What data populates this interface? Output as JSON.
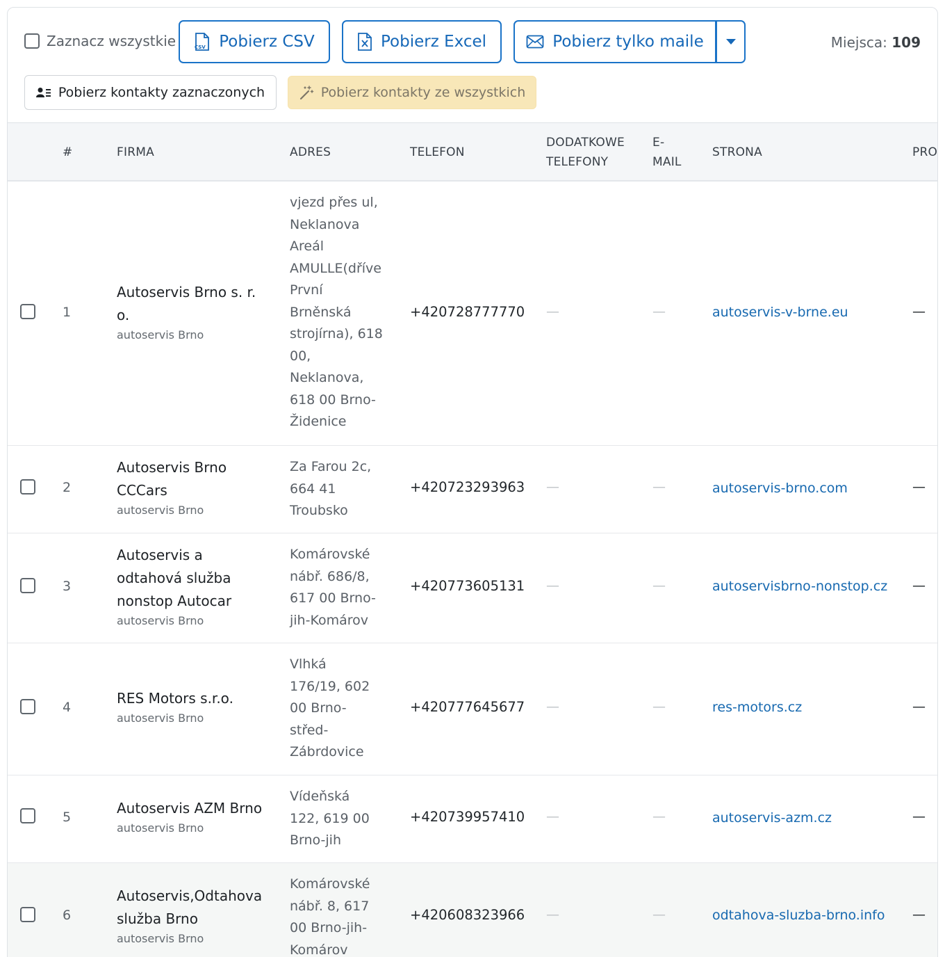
{
  "toolbar": {
    "select_all": "Zaznacz wszystkie",
    "csv": "Pobierz CSV",
    "excel": "Pobierz Excel",
    "mail": "Pobierz tylko maile",
    "seats_label": "Miejsca:",
    "seats_value": "109",
    "contacts_selected": "Pobierz kontakty zaznaczonych",
    "contacts_all": "Pobierz kontakty ze wszystkich"
  },
  "headers": {
    "num": "#",
    "firm": "FIRMA",
    "address": "ADRES",
    "phone": "TELEFON",
    "extra_phones_1": "DODATKOWE",
    "extra_phones_2": "TELEFONY",
    "email_1": "E-",
    "email_2": "MAIL",
    "site": "STRONA",
    "pro": "PRO"
  },
  "empty": "—",
  "rows": [
    {
      "num": "1",
      "firm_line1": "Autoservis Brno s. r.",
      "firm_line2": "o.",
      "category": "autoservis Brno",
      "addr": [
        "vjezd přes ul,",
        "Neklanova",
        "Areál",
        "AMULLE(dříve",
        "První",
        "Brněnská",
        "strojírna), 618",
        "00,",
        "Neklanova,",
        "618 00 Brno-",
        "Židenice"
      ],
      "phone": "+420728777770",
      "site": "autoservis-v-brne.eu"
    },
    {
      "num": "2",
      "firm_line1": "Autoservis Brno",
      "firm_line2": "CCCars",
      "category": "autoservis Brno",
      "addr": [
        "Za Farou 2c,",
        "664 41",
        "Troubsko"
      ],
      "phone": "+420723293963",
      "site": "autoservis-brno.com"
    },
    {
      "num": "3",
      "firm_line1": "Autoservis a",
      "firm_line2": "odtahová služba",
      "firm_line3": "nonstop Autocar",
      "category": "autoservis Brno",
      "addr": [
        "Komárovské",
        "nábř. 686/8,",
        "617 00 Brno-",
        "jih-Komárov"
      ],
      "phone": "+420773605131",
      "site": "autoservisbrno-nonstop.cz"
    },
    {
      "num": "4",
      "firm_line1": "RES Motors s.r.o.",
      "category": "autoservis Brno",
      "addr": [
        "Vlhká",
        "176/19, 602",
        "00 Brno-",
        "střed-",
        "Zábrdovice"
      ],
      "phone": "+420777645677",
      "site": "res-motors.cz"
    },
    {
      "num": "5",
      "firm_line1": "Autoservis AZM Brno",
      "category": "autoservis Brno",
      "addr": [
        "Vídeňská",
        "122, 619 00",
        "Brno-jih"
      ],
      "phone": "+420739957410",
      "site": "autoservis-azm.cz"
    },
    {
      "num": "6",
      "firm_line1": "Autoservis,Odtahova",
      "firm_line2": "služba Brno",
      "category": "autoservis Brno",
      "addr": [
        "Komárovské",
        "nábř. 8, 617",
        "00 Brno-jih-",
        "Komárov"
      ],
      "phone": "+420608323966",
      "site": "odtahova-sluzba-brno.info"
    }
  ]
}
